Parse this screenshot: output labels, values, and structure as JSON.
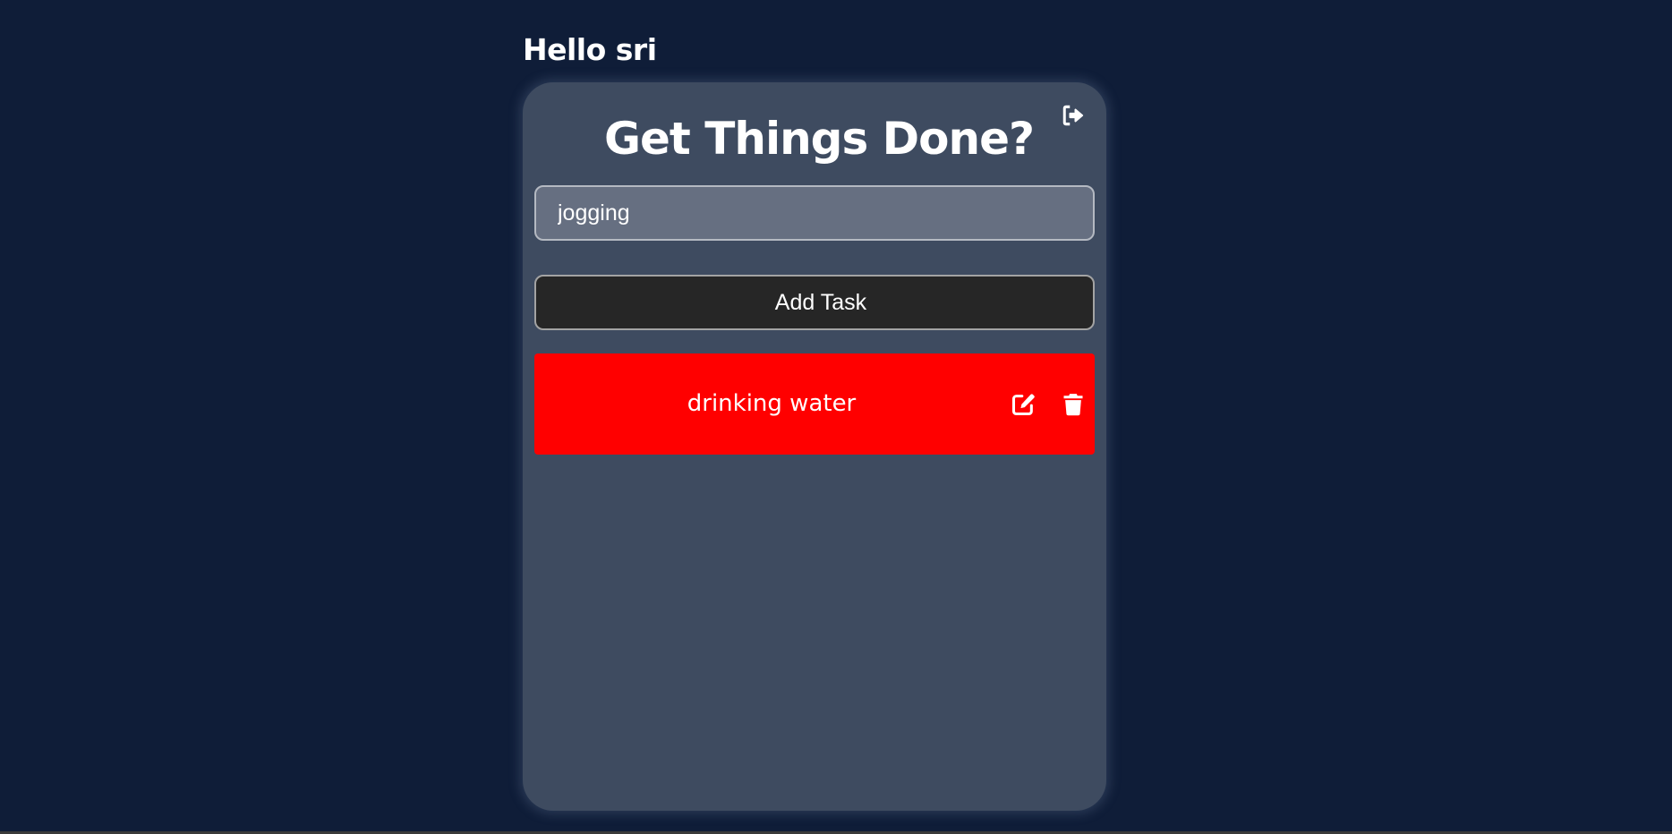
{
  "greeting": "Hello sri",
  "card": {
    "heading": "Get Things Done?",
    "logout_icon": "logout-icon",
    "input": {
      "value": "jogging",
      "placeholder": ""
    },
    "add_button_label": "Add Task",
    "tasks": [
      {
        "text": "drinking water",
        "color": "#ff0000",
        "edit_icon": "edit-icon",
        "delete_icon": "trash-icon"
      }
    ]
  },
  "colors": {
    "background": "#0f1d38",
    "card": "#3e4b60",
    "input": "#666f81",
    "button": "#262626",
    "task": "#ff0000"
  }
}
